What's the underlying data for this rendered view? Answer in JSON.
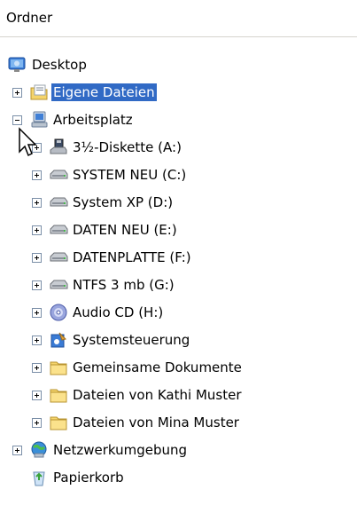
{
  "header": {
    "title": "Ordner"
  },
  "tree": {
    "desktop": {
      "label": "Desktop"
    },
    "eigene_dateien": {
      "label": "Eigene Dateien",
      "selected": true
    },
    "arbeitsplatz": {
      "label": "Arbeitsplatz",
      "expanded": true
    },
    "children": [
      {
        "label": "3½-Diskette (A:)",
        "icon": "floppy-drive-icon"
      },
      {
        "label": "SYSTEM NEU (C:)",
        "icon": "hard-drive-icon"
      },
      {
        "label": "System XP (D:)",
        "icon": "hard-drive-icon"
      },
      {
        "label": "DATEN NEU (E:)",
        "icon": "hard-drive-icon"
      },
      {
        "label": "DATENPLATTE (F:)",
        "icon": "hard-drive-icon"
      },
      {
        "label": "NTFS 3 mb (G:)",
        "icon": "hard-drive-icon"
      },
      {
        "label": "Audio CD (H:)",
        "icon": "cd-drive-icon"
      },
      {
        "label": "Systemsteuerung",
        "icon": "control-panel-icon"
      },
      {
        "label": "Gemeinsame Dokumente",
        "icon": "folder-icon"
      },
      {
        "label": "Dateien von Kathi Muster",
        "icon": "folder-icon"
      },
      {
        "label": "Dateien von Mina Muster",
        "icon": "folder-icon"
      }
    ],
    "netzwerk": {
      "label": "Netzwerkumgebung"
    },
    "papierkorb": {
      "label": "Papierkorb"
    }
  },
  "colors": {
    "selection": "#316ac5",
    "expander_border": "#7b8fa8",
    "folder": "#f5d46b"
  }
}
